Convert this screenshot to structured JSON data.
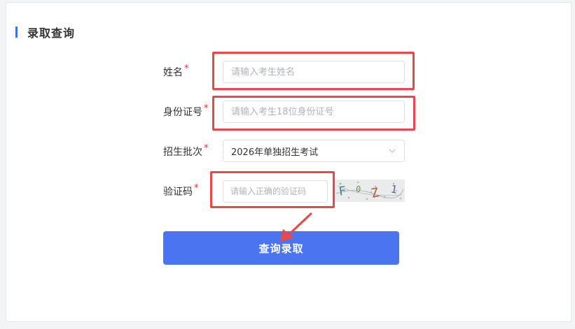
{
  "section": {
    "title": "录取查询"
  },
  "form": {
    "name": {
      "label": "姓名",
      "required_mark": "*",
      "placeholder": "请输入考生姓名",
      "value": ""
    },
    "id_number": {
      "label": "身份证号",
      "required_mark": "*",
      "placeholder": "请输入考生18位身份证号",
      "value": ""
    },
    "batch": {
      "label": "招生批次",
      "required_mark": "*",
      "selected": "2026年单独招生考试"
    },
    "captcha": {
      "label": "验证码",
      "required_mark": "*",
      "placeholder": "请输入正确的验证码",
      "value": "",
      "image_text": "F0Z1"
    },
    "submit_label": "查询录取"
  },
  "colors": {
    "accent": "#3d6fe8",
    "button": "#4a74f0",
    "required": "#e0322b",
    "highlight": "#e8484b"
  }
}
